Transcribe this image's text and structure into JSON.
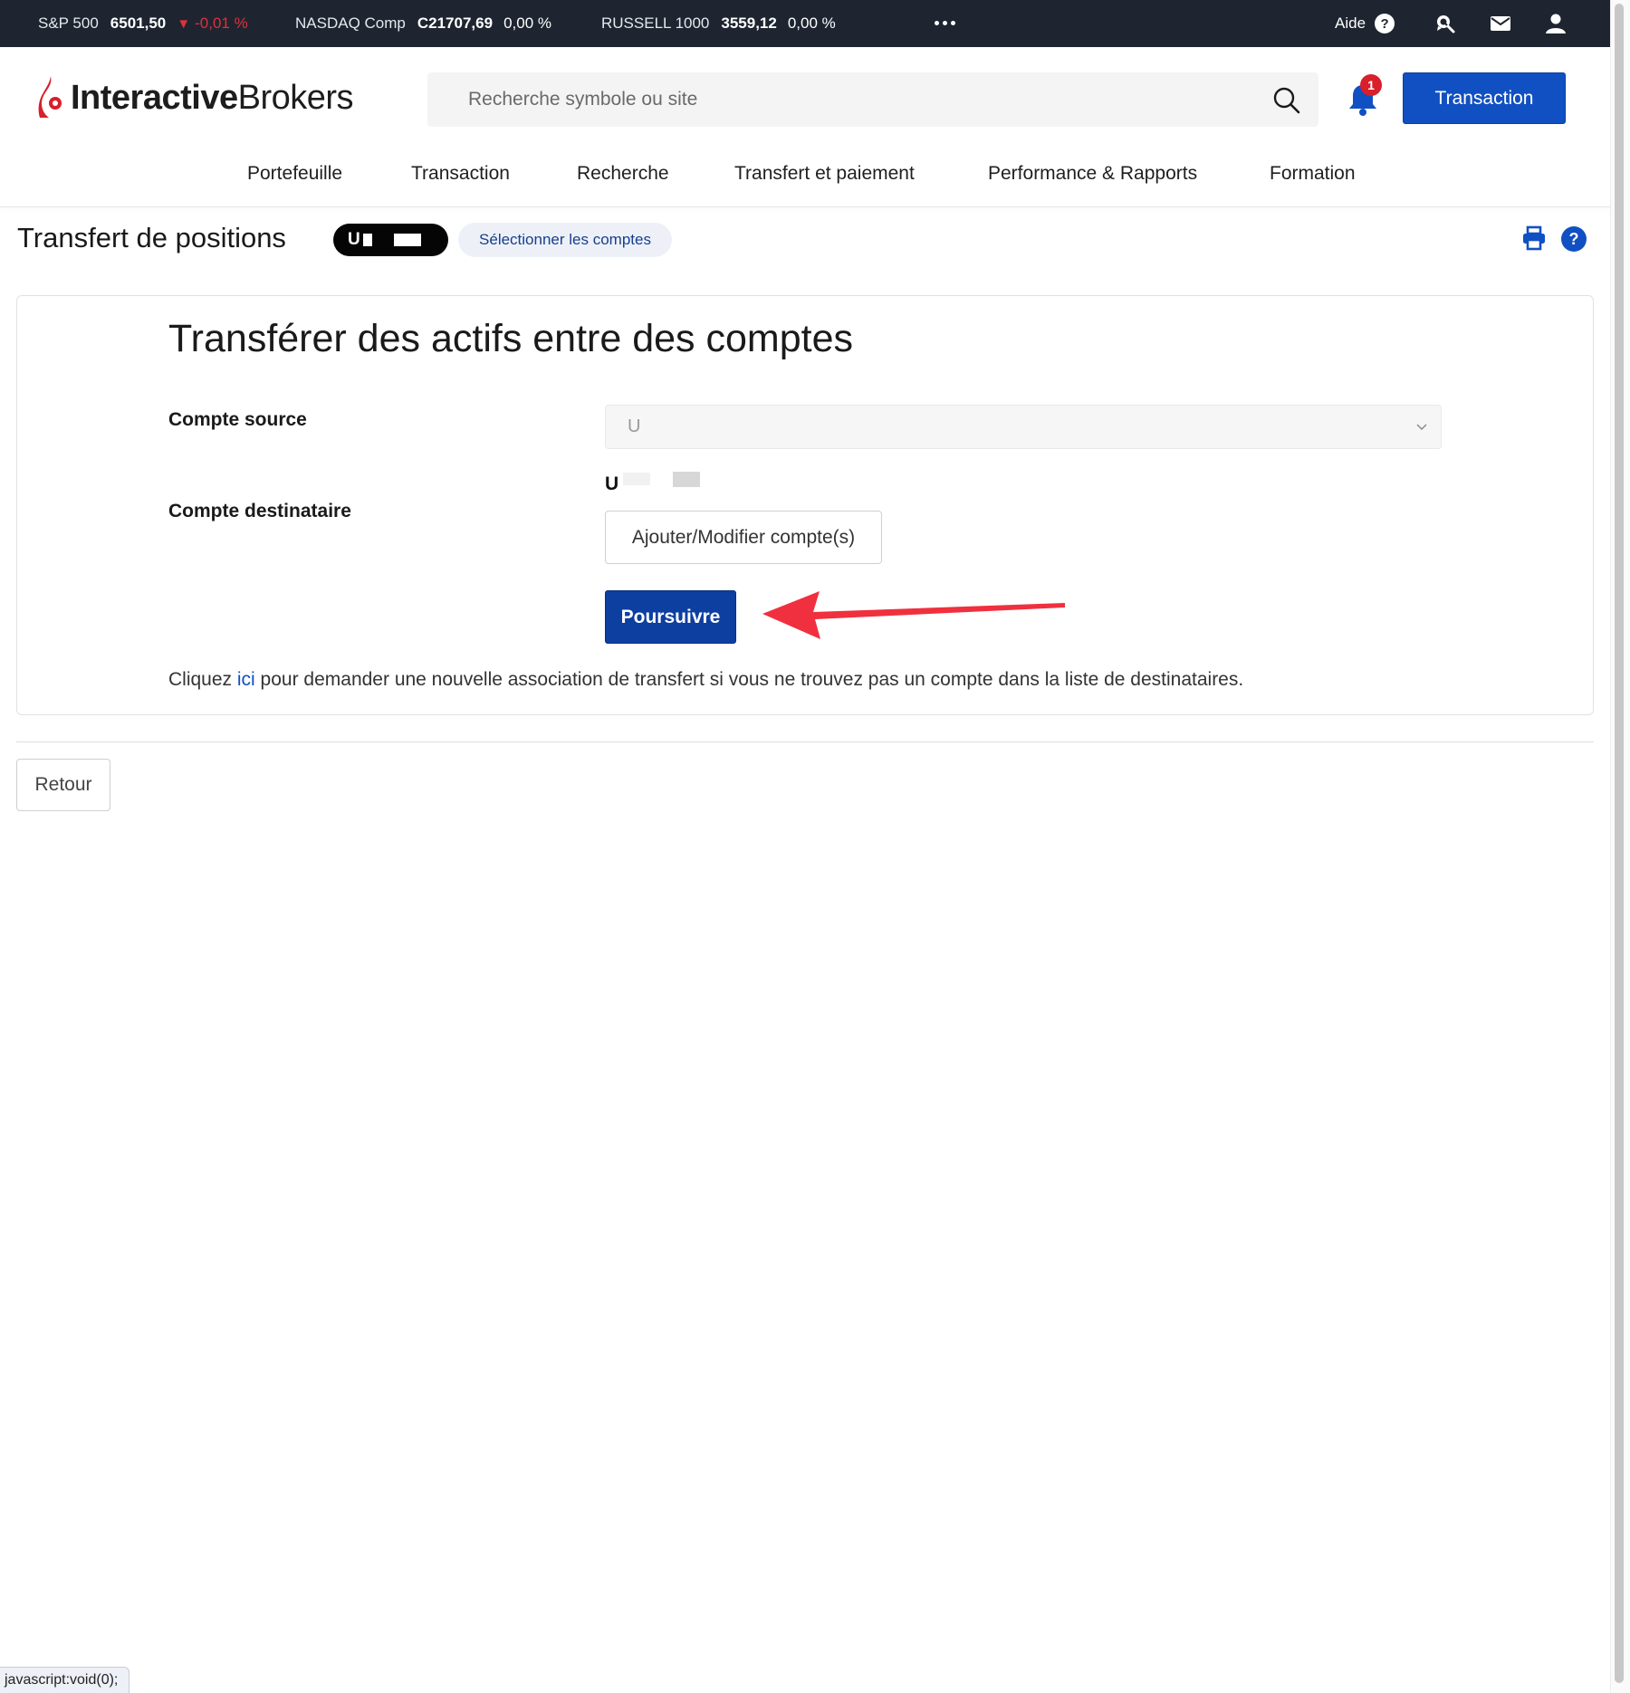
{
  "ticker": {
    "items": [
      {
        "name": "S&P 500",
        "price": "6501,50",
        "change": "-0,01 %",
        "direction": "down"
      },
      {
        "name": "NASDAQ Comp",
        "price": "C21707,69",
        "change": "0,00 %",
        "direction": "flat"
      },
      {
        "name": "RUSSELL 1000",
        "price": "3559,12",
        "change": "0,00 %",
        "direction": "flat"
      }
    ],
    "more_icon": "ellipsis-icon",
    "help_label": "Aide",
    "help_glyph": "?",
    "icons": [
      "help-circle-icon",
      "chat-search-icon",
      "mail-icon",
      "user-icon"
    ]
  },
  "header": {
    "logo_bold": "Interactive",
    "logo_light": "Brokers",
    "search_placeholder": "Recherche symbole ou site",
    "notification_count": "1",
    "trade_button": "Transaction"
  },
  "nav": {
    "items": [
      {
        "label": "Portefeuille"
      },
      {
        "label": "Transaction"
      },
      {
        "label": "Recherche"
      },
      {
        "label": "Transfert et paiement"
      },
      {
        "label": "Performance & Rapports"
      },
      {
        "label": "Formation"
      }
    ]
  },
  "page": {
    "title": "Transfert de positions",
    "account_prefix": "U",
    "select_accounts": "Sélectionner les comptes",
    "help_glyph": "?"
  },
  "form": {
    "heading": "Transférer des actifs entre des comptes",
    "source_label": "Compte source",
    "source_value": "U",
    "destination_label": "Compte destinataire",
    "destination_prefix": "U",
    "add_modify_button": "Ajouter/Modifier compte(s)",
    "continue_button": "Poursuivre",
    "footnote_before": "Cliquez ",
    "footnote_link": "ici",
    "footnote_after": " pour demander une nouvelle association de transfert si vous ne trouvez pas un compte dans la liste de destinataires."
  },
  "back_button": "Retour",
  "status_bar": "javascript:void(0);",
  "colors": {
    "ticker_bg": "#1e2530",
    "brand_red": "#d81f2a",
    "primary_blue": "#1150c2",
    "continue_blue": "#0d3fa0",
    "annotation_arrow": "#f0303e"
  }
}
